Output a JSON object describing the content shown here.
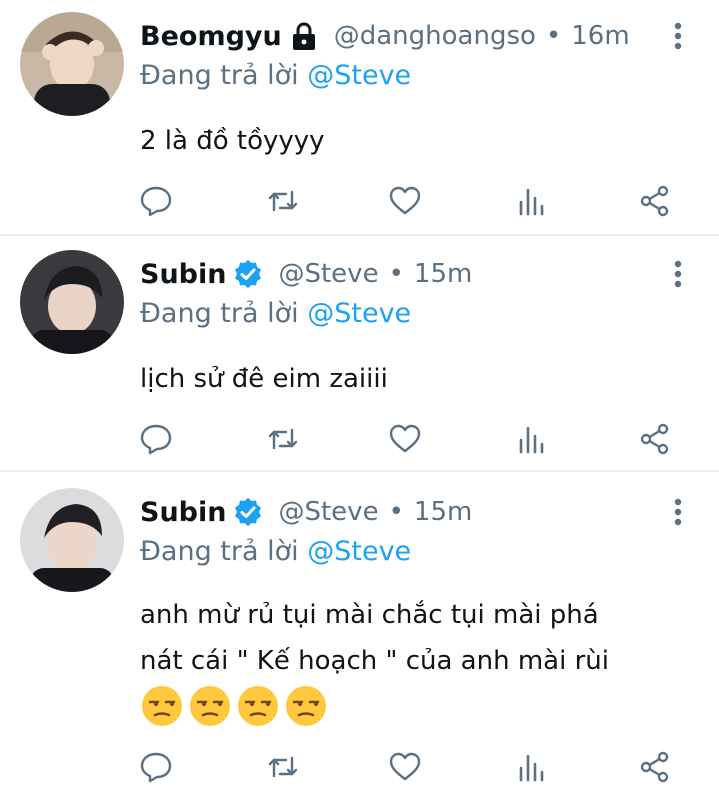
{
  "tweets": [
    {
      "name": "Beomgyu",
      "badge_icon": "lock-icon",
      "handle": "@danghoangso",
      "separator": "•",
      "time": "16m",
      "reply_prefix": "Đang trả lời",
      "reply_mention": "@Steve",
      "lines": [
        "2 là đồ tồyyyy"
      ]
    },
    {
      "name": "Subin",
      "badge_icon": "verified-badge-icon",
      "handle": "@Steve",
      "separator": "•",
      "time": "15m",
      "reply_prefix": "Đang trả lời",
      "reply_mention": "@Steve",
      "lines": [
        "lịch sử đê eim zaiiii"
      ]
    },
    {
      "name": "Subin",
      "badge_icon": "verified-badge-icon",
      "handle": "@Steve",
      "separator": "•",
      "time": "15m",
      "reply_prefix": "Đang trả lời",
      "reply_mention": "@Steve",
      "lines": [
        "anh mừ rủ tụi mài chắc tụi mài phá",
        "nát cái \" Kế hoạch \" của anh mài rùi"
      ],
      "emojis": [
        "unamused-face-emoji",
        "unamused-face-emoji",
        "unamused-face-emoji",
        "unamused-face-emoji"
      ]
    }
  ],
  "colors": {
    "accent": "#1da1f2",
    "secondary_text": "#5b7083",
    "icon": "#5b7083",
    "divider": "#e6ecf0"
  }
}
